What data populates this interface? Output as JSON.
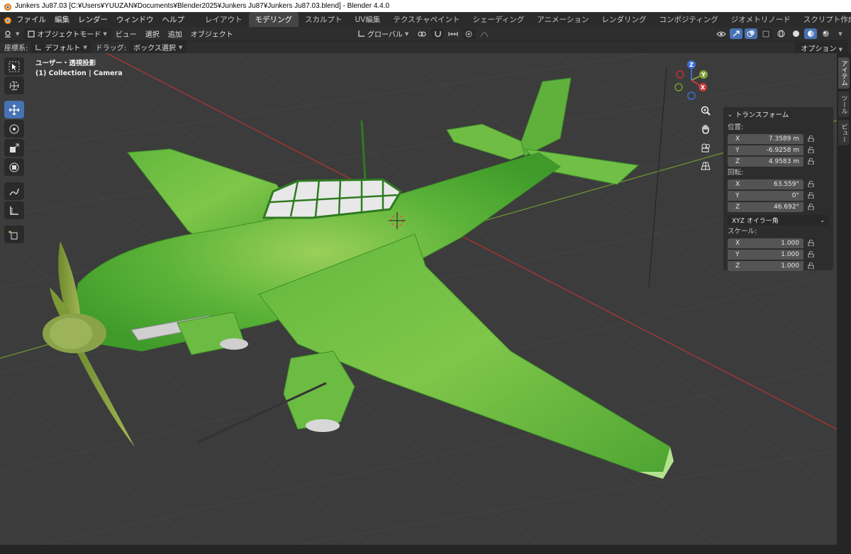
{
  "window": {
    "title": "Junkers Ju87.03 [C:¥Users¥YUUZAN¥Documents¥Blender2025¥Junkers Ju87¥Junkers Ju87.03.blend] - Blender 4.4.0"
  },
  "menu": {
    "items": [
      "ファイル",
      "編集",
      "レンダー",
      "ウィンドウ",
      "ヘルプ"
    ]
  },
  "workspaces": {
    "tabs": [
      "レイアウト",
      "モデリング",
      "スカルプト",
      "UV編集",
      "テクスチャペイント",
      "シェーディング",
      "アニメーション",
      "レンダリング",
      "コンポジティング",
      "ジオメトリノード",
      "スクリプト作成"
    ],
    "active": "モデリング",
    "add_label": "+"
  },
  "header": {
    "mode": "オブジェクトモード",
    "menus": [
      "ビュー",
      "選択",
      "追加",
      "オブジェクト"
    ],
    "transform_orientation": "グローバル"
  },
  "tool_settings": {
    "coord_label": "座標系:",
    "coord_value": "デフォルト",
    "drag_label": "ドラッグ:",
    "drag_value": "ボックス選択",
    "options_label": "オプション"
  },
  "viewport": {
    "view_name": "ユーザー・透視投影",
    "collection_info": "(1) Collection | Camera",
    "gizmo_axes": {
      "x": "X",
      "y": "Y",
      "z": "Z"
    }
  },
  "npanel": {
    "section_title": "トランスフォーム",
    "location_label": "位置:",
    "location": [
      {
        "axis": "X",
        "value": "7.3589 m"
      },
      {
        "axis": "Y",
        "value": "-6.9258 m"
      },
      {
        "axis": "Z",
        "value": "4.9583 m"
      }
    ],
    "rotation_label": "回転:",
    "rotation": [
      {
        "axis": "X",
        "value": "63.559°"
      },
      {
        "axis": "Y",
        "value": "0°"
      },
      {
        "axis": "Z",
        "value": "46.692°"
      }
    ],
    "rotation_mode": "XYZ オイラー角",
    "scale_label": "スケール:",
    "scale": [
      {
        "axis": "X",
        "value": "1.000"
      },
      {
        "axis": "Y",
        "value": "1.000"
      },
      {
        "axis": "Z",
        "value": "1.000"
      }
    ]
  },
  "side_tabs": [
    "アイテム",
    "ツール",
    "ビュー"
  ],
  "colors": {
    "accent": "#4772b3",
    "viewport_bg": "#3c3c3c",
    "axis_x": "#c13a3a",
    "axis_y": "#7fa23a",
    "axis_z": "#3b6fd6",
    "plane_green": "#58b23a"
  }
}
